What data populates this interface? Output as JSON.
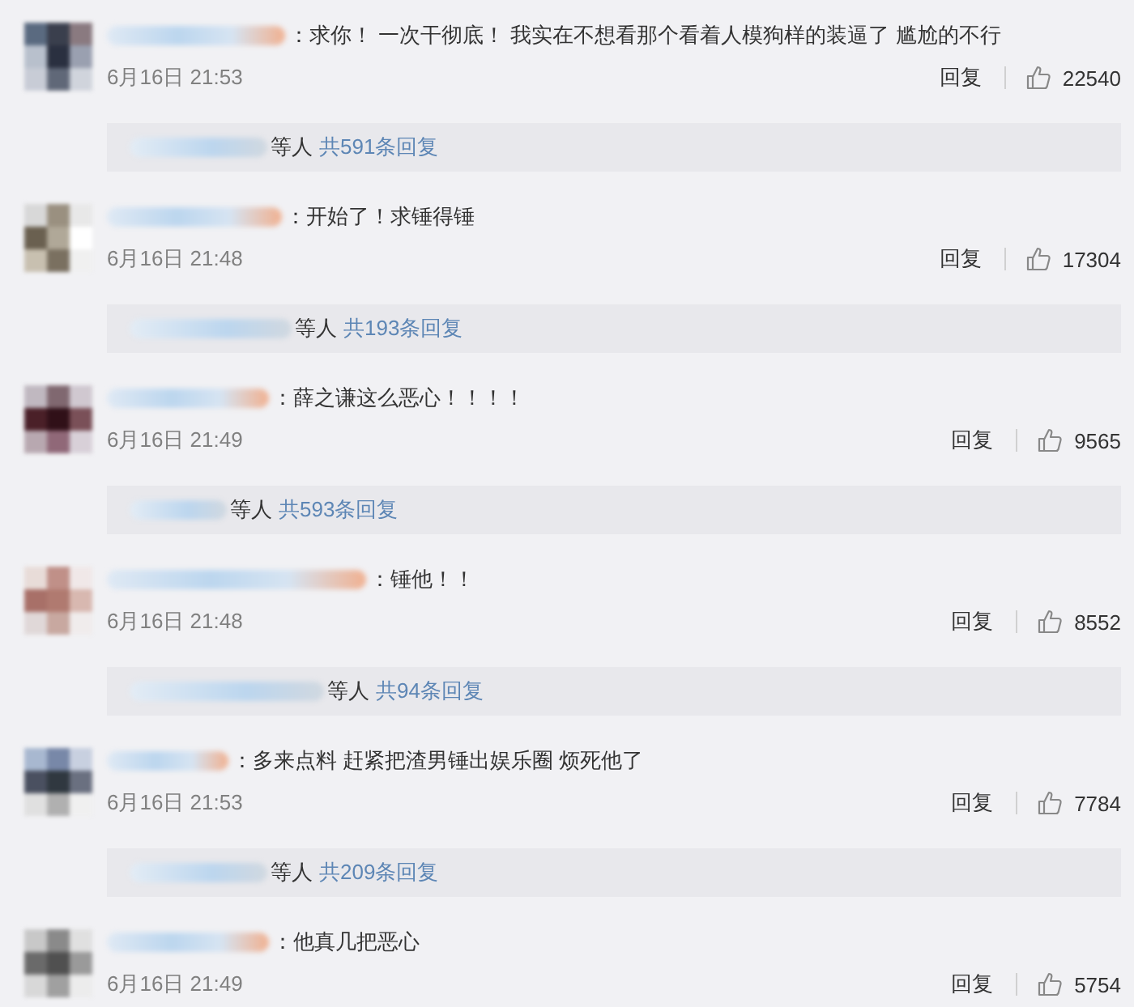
{
  "comments": [
    {
      "text": "：求你！ 一次干彻底！ 我实在不想看那个看着人模狗样的装逼了  尴尬的不行",
      "time": "6月16日 21:53",
      "reply": "回复",
      "likes": "22540",
      "thread": {
        "suffix": "等人",
        "count": "共591条回复"
      }
    },
    {
      "text": "：开始了！求锤得锤",
      "time": "6月16日 21:48",
      "reply": "回复",
      "likes": "17304",
      "thread": {
        "suffix": "等人",
        "count": "共193条回复"
      }
    },
    {
      "text": "：薛之谦这么恶心！！！！",
      "time": "6月16日 21:49",
      "reply": "回复",
      "likes": "9565",
      "thread": {
        "suffix": "等人",
        "count": "共593条回复"
      }
    },
    {
      "text": "：锤他！！",
      "time": "6月16日 21:48",
      "reply": "回复",
      "likes": "8552",
      "thread": {
        "suffix": "等人",
        "count": "共94条回复"
      }
    },
    {
      "text": "：多来点料  赶紧把渣男锤出娱乐圈  烦死他了",
      "time": "6月16日 21:53",
      "reply": "回复",
      "likes": "7784",
      "thread": {
        "suffix": "等人",
        "count": "共209条回复"
      }
    },
    {
      "text": "：他真几把恶心",
      "time": "6月16日 21:49",
      "reply": "回复",
      "likes": "5754"
    }
  ]
}
